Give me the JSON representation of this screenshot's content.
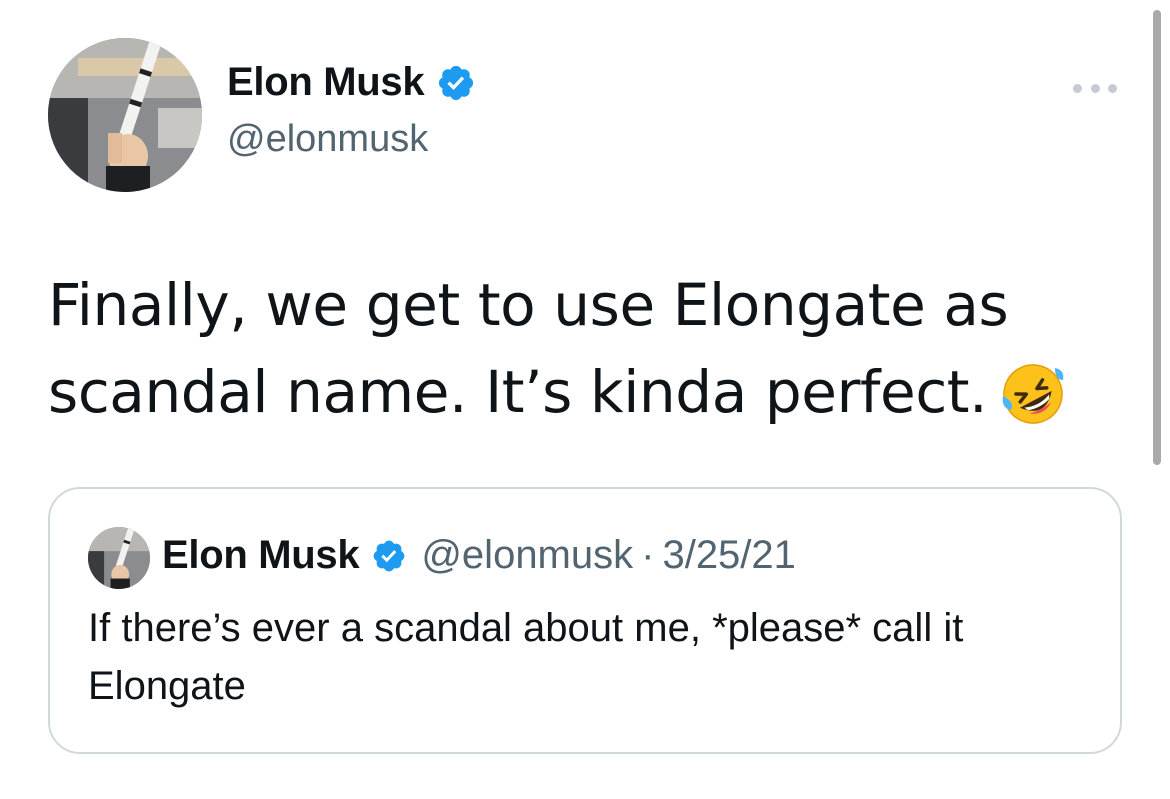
{
  "tweet": {
    "display_name": "Elon Musk",
    "handle": "@elonmusk",
    "text": "Finally, we get to use Elongate as scandal name. It’s kinda perfect.",
    "emoji_name": "rolling-on-the-floor-laughing",
    "more_icon": "more-horizontal-icon"
  },
  "quoted": {
    "display_name": "Elon Musk",
    "handle": "@elonmusk",
    "separator": "·",
    "date": "3/25/21",
    "text": "If there’s ever a scandal about me, *please* call it Elongate"
  },
  "colors": {
    "verified": "#1d9bf0",
    "secondary_text": "#536471",
    "primary_text": "#0f1419",
    "border": "#cfd9de"
  }
}
